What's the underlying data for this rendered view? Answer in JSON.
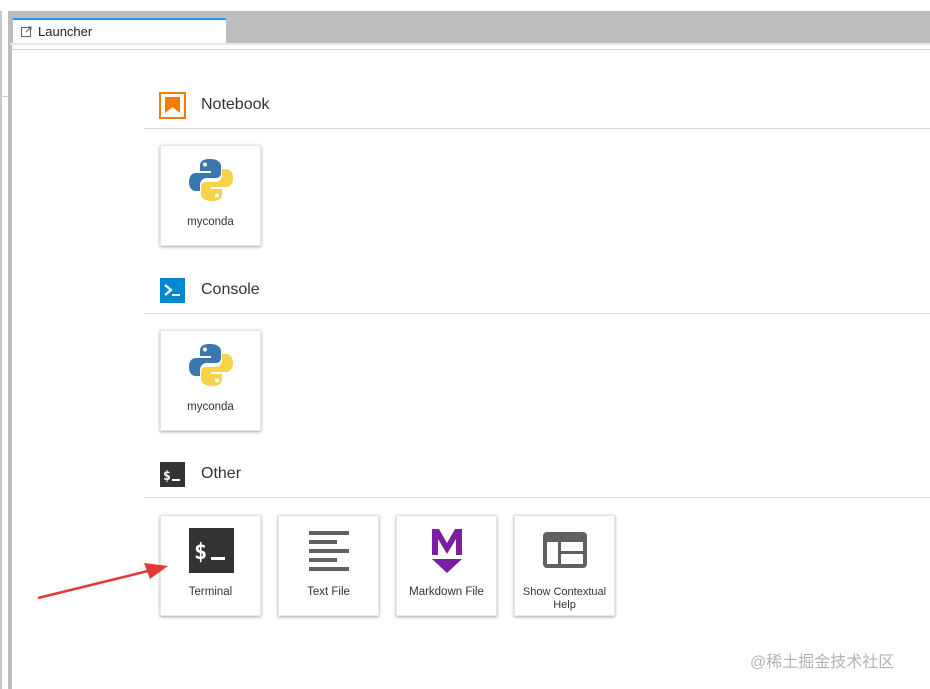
{
  "tab": {
    "label": "Launcher",
    "icon": "launcher-icon"
  },
  "sections": [
    {
      "title": "Notebook",
      "icon": "notebook-icon",
      "accent": "#f57c00",
      "cards": [
        {
          "label": "myconda",
          "icon": "python-icon"
        }
      ]
    },
    {
      "title": "Console",
      "icon": "console-icon",
      "accent": "#0288d1",
      "cards": [
        {
          "label": "myconda",
          "icon": "python-icon"
        }
      ]
    },
    {
      "title": "Other",
      "icon": "terminal-icon",
      "accent": "#333333",
      "cards": [
        {
          "label": "Terminal",
          "icon": "terminal-icon"
        },
        {
          "label": "Text File",
          "icon": "text-file-icon"
        },
        {
          "label": "Markdown File",
          "icon": "markdown-icon"
        },
        {
          "label": "Show Contextual Help",
          "icon": "contextual-help-icon"
        }
      ]
    }
  ],
  "annotation": {
    "icon": "red-arrow-icon",
    "color": "#e53935"
  },
  "watermark": "@稀土掘金技术社区"
}
